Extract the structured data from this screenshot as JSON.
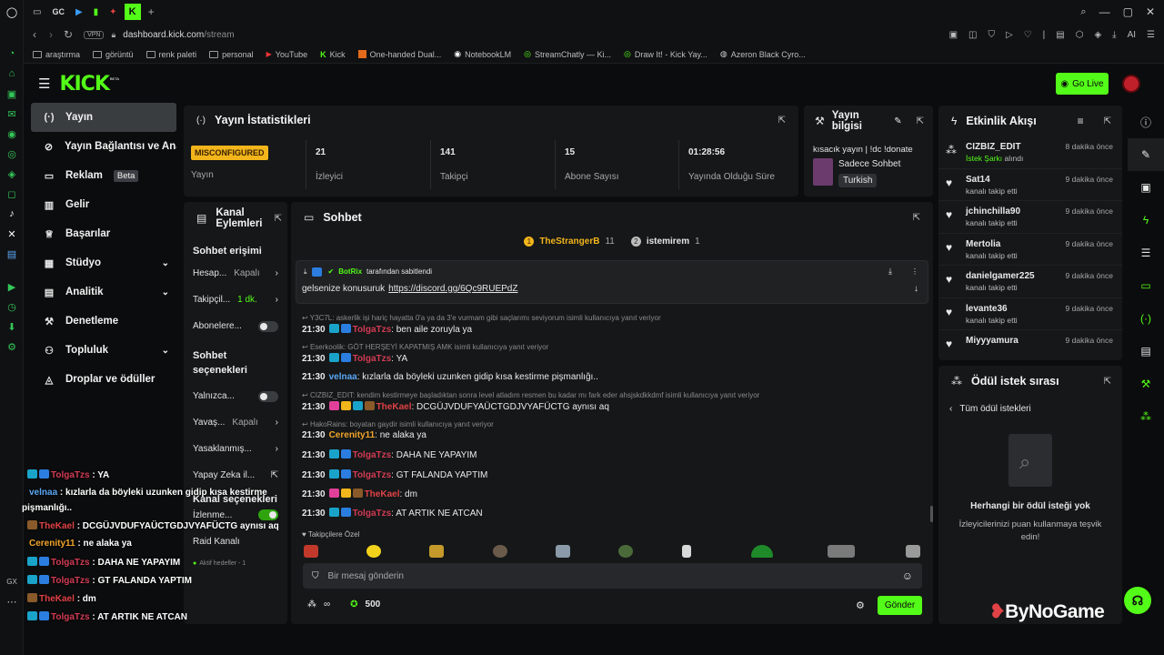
{
  "browser": {
    "address": "dashboard.kick.com/stream",
    "address_host": "dashboard.kick.com",
    "address_path": "/stream",
    "vpn_label": "VPN",
    "gx_label": "GX",
    "ai_label": "AI",
    "tab_short": "GC",
    "bookmarks": [
      "araştırma",
      "görüntü",
      "renk paleti",
      "personal",
      "YouTube",
      "Kick",
      "One-handed Dual...",
      "NotebookLM",
      "StreamChatly — Ki...",
      "Draw It! - Kick Yay...",
      "Azeron Black Cyro..."
    ]
  },
  "app": {
    "logo": "KICK",
    "logo_badge": "BETA",
    "go_live": "Go Live"
  },
  "nav": {
    "items": [
      {
        "label": "Yayın",
        "icon": "broadcast-icon"
      },
      {
        "label": "Yayın Bağlantısı ve Anahtarı",
        "icon": "link-icon"
      },
      {
        "label": "Reklam",
        "icon": "ad-icon",
        "badge": "Beta"
      },
      {
        "label": "Gelir",
        "icon": "revenue-icon"
      },
      {
        "label": "Başarılar",
        "icon": "trophy-icon"
      },
      {
        "label": "Stüdyo",
        "icon": "studio-icon"
      },
      {
        "label": "Analitik",
        "icon": "analytics-icon"
      },
      {
        "label": "Denetleme",
        "icon": "moderation-icon"
      },
      {
        "label": "Topluluk",
        "icon": "community-icon"
      },
      {
        "label": "Droplar ve ödüller",
        "icon": "drops-icon"
      }
    ]
  },
  "stats": {
    "title": "Yayın İstatistikleri",
    "status_badge": "MISCONFIGURED",
    "status_label": "Yayın",
    "viewers": "21",
    "viewers_label": "İzleyici",
    "followers": "141",
    "followers_label": "Takipçi",
    "subs": "15",
    "subs_label": "Abone Sayısı",
    "uptime": "01:28:56",
    "uptime_label": "Yayında Olduğu Süre"
  },
  "info": {
    "title": "Yayın bilgisi",
    "stream_title": "kısacık yayın | !dc !donate",
    "category": "Sadece Sohbet",
    "language": "Turkish"
  },
  "activity": {
    "title": "Etkinlik Akışı",
    "items": [
      {
        "name": "CIZBIZ_EDIT",
        "sub_green": "İstek Şarkı",
        "sub": " alındı",
        "time": "8 dakika önce"
      },
      {
        "name": "Sat14",
        "sub": "kanalı takip etti",
        "time": "9 dakika önce"
      },
      {
        "name": "jchinchilla90",
        "sub": "kanalı takip etti",
        "time": "9 dakika önce"
      },
      {
        "name": "Mertolia",
        "sub": "kanalı takip etti",
        "time": "9 dakika önce"
      },
      {
        "name": "danielgamer225",
        "sub": "kanalı takip etti",
        "time": "9 dakika önce"
      },
      {
        "name": "levante36",
        "sub": "kanalı takip etti",
        "time": "9 dakika önce"
      },
      {
        "name": "Miyyyamura",
        "sub": "kanalı takip etti",
        "time": "9 dakika önce"
      }
    ]
  },
  "reward": {
    "title": "Ödül istek sırası",
    "back": "Tüm ödül istekleri",
    "empty_title": "Herhangi bir ödül isteği yok",
    "empty_desc": "İzleyicilerinizi puan kullanmaya teşvik edin!"
  },
  "channel": {
    "title": "Kanal Eylemleri",
    "chat_access": "Sohbet erişimi",
    "rows1": [
      {
        "label": "Hesap...",
        "value": "Kapalı",
        "kind": "arrow"
      },
      {
        "label": "Takipçil...",
        "value": "1 dk.",
        "kind": "arrow-green"
      },
      {
        "label": "Abonelere...",
        "kind": "toggle"
      }
    ],
    "chat_options": "Sohbet seçenekleri",
    "rows2": [
      {
        "label": "Yalnızca...",
        "kind": "toggle"
      },
      {
        "label": "Yavaş...",
        "value": "Kapalı",
        "kind": "arrow"
      },
      {
        "label": "Yasaklanmış...",
        "kind": "arrow"
      },
      {
        "label": "Yapay Zeka il...",
        "kind": "ext"
      }
    ],
    "channel_options": "Kanal seçenekleri",
    "watch": "İzlenme...",
    "raid": "Raid Kanalı",
    "goals": "Aktif hedefler - 1"
  },
  "chat": {
    "title": "Sohbet",
    "top1_name": "TheStrangerB",
    "top1_count": "11",
    "top2_name": "istemirem",
    "top2_count": "1",
    "pinned_by": "BotRix",
    "pinned_suffix": "tarafından sabitlendi",
    "pinned_text": "gelsenize konusuruk",
    "pinned_link": "https://discord.gg/6Qc9RUEPdZ",
    "messages": [
      {
        "reply": "Y3C7L: askerlik işi hariç hayatta 0'a ya da 3'e vurmam gibi saçlarımı seviyorum isimli kullanıcıya yanıt veriyor",
        "time": "21:30",
        "user": "TolgaTzs",
        "cls": "u-tolga",
        "text": "ben aile zoruyla ya"
      },
      {
        "reply": "Eserkoolik: GÖT HERŞEYİ KAPATMIŞ AMK isimli kullanıcıya yanıt veriyor",
        "time": "21:30",
        "user": "TolgaTzs",
        "cls": "u-tolga",
        "text": "YA"
      },
      {
        "time": "21:30",
        "user": "velnaa",
        "cls": "u-vel",
        "text": "kızlarla da böyleki uzunken gidip kısa kestirme pişmanlığı.."
      },
      {
        "reply": "CIZBIZ_EDIT: kendim kestirmeye başladıktan sonra level atladım resmen bu kadar mı fark eder ahsjskdkkdmf isimli kullanıcıya yanıt veriyor",
        "time": "21:30",
        "user": "TheKael",
        "cls": "u-kael",
        "text": "DCGÜJVDUFYAÜCTGDJVYAFÜCTG aynısı aq"
      },
      {
        "reply": "HakoRains: boyatan gaydir isimli kullanıcıya yanıt veriyor",
        "time": "21:30",
        "user": "Cerenity11",
        "cls": "u-ceren",
        "text": "ne alaka ya"
      },
      {
        "time": "21:30",
        "user": "TolgaTzs",
        "cls": "u-tolga",
        "text": "DAHA NE YAPAYIM"
      },
      {
        "time": "21:30",
        "user": "TolgaTzs",
        "cls": "u-tolga",
        "text": "GT FALANDA YAPTIM"
      },
      {
        "time": "21:30",
        "user": "TheKael",
        "cls": "u-kael",
        "text": "dm"
      },
      {
        "time": "21:30",
        "user": "TolgaTzs",
        "cls": "u-tolga",
        "text": "AT ARTIK NE ATCAN"
      }
    ],
    "emote_section": "Takipçilere Özel",
    "input_placeholder": "Bir mesaj gönderin",
    "points": "500",
    "send": "Gönder"
  },
  "overlay": [
    {
      "user": "TolgaTzs",
      "text": ": YA",
      "color": "#d33b54"
    },
    {
      "user": "velnaa",
      "text": ": kızlarla da böyleki uzunken gidip kısa kestirme",
      "color": "#5aa7f5"
    },
    {
      "user": "",
      "text": "pişmanlığı..",
      "color": "#ffffff"
    },
    {
      "user": "TheKael",
      "text": ": DCGÜJVDUFYAÜCTGDJVYAFÜCTG aynısı aq",
      "color": "#e04246"
    },
    {
      "user": "Cerenity11",
      "text": ": ne alaka ya",
      "color": "#f2a52a"
    },
    {
      "user": "TolgaTzs",
      "text": ": DAHA NE YAPAYIM",
      "color": "#d33b54"
    },
    {
      "user": "TolgaTzs",
      "text": ": GT FALANDA YAPTIM",
      "color": "#d33b54"
    },
    {
      "user": "TheKael",
      "text": ": dm",
      "color": "#e04246"
    },
    {
      "user": "TolgaTzs",
      "text": ": AT ARTIK NE ATCAN",
      "color": "#d33b54"
    }
  ],
  "watermark": "ByNoGame",
  "colors": {
    "accent": "#53fc18",
    "badge": "#f2b51b"
  }
}
